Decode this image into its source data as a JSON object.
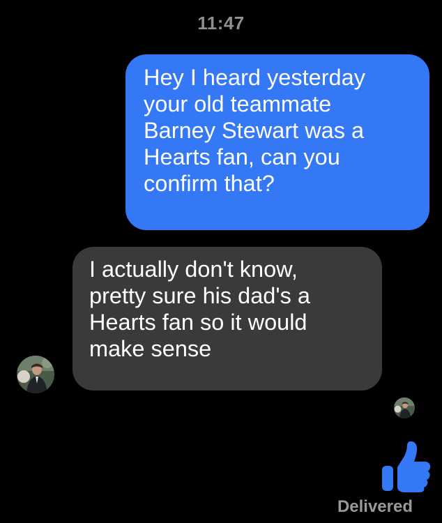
{
  "header": {
    "time": "11:47"
  },
  "messages": [
    {
      "direction": "sent",
      "text": "Hey I heard yesterday\nyour old teammate\nBarney Stewart was a\nHearts fan, can you\nconfirm that?"
    },
    {
      "direction": "received",
      "text": "I actually don't know,\npretty sure his dad's a\nHearts fan so it would\nmake sense"
    }
  ],
  "reaction": {
    "icon": "thumbs-up-icon",
    "color": "#3478f6"
  },
  "footer": {
    "status": "Delivered"
  },
  "colors": {
    "background": "#000000",
    "sent_bubble": "#3478f6",
    "received_bubble": "#3a3a3c",
    "timestamp": "#8e8e93"
  }
}
